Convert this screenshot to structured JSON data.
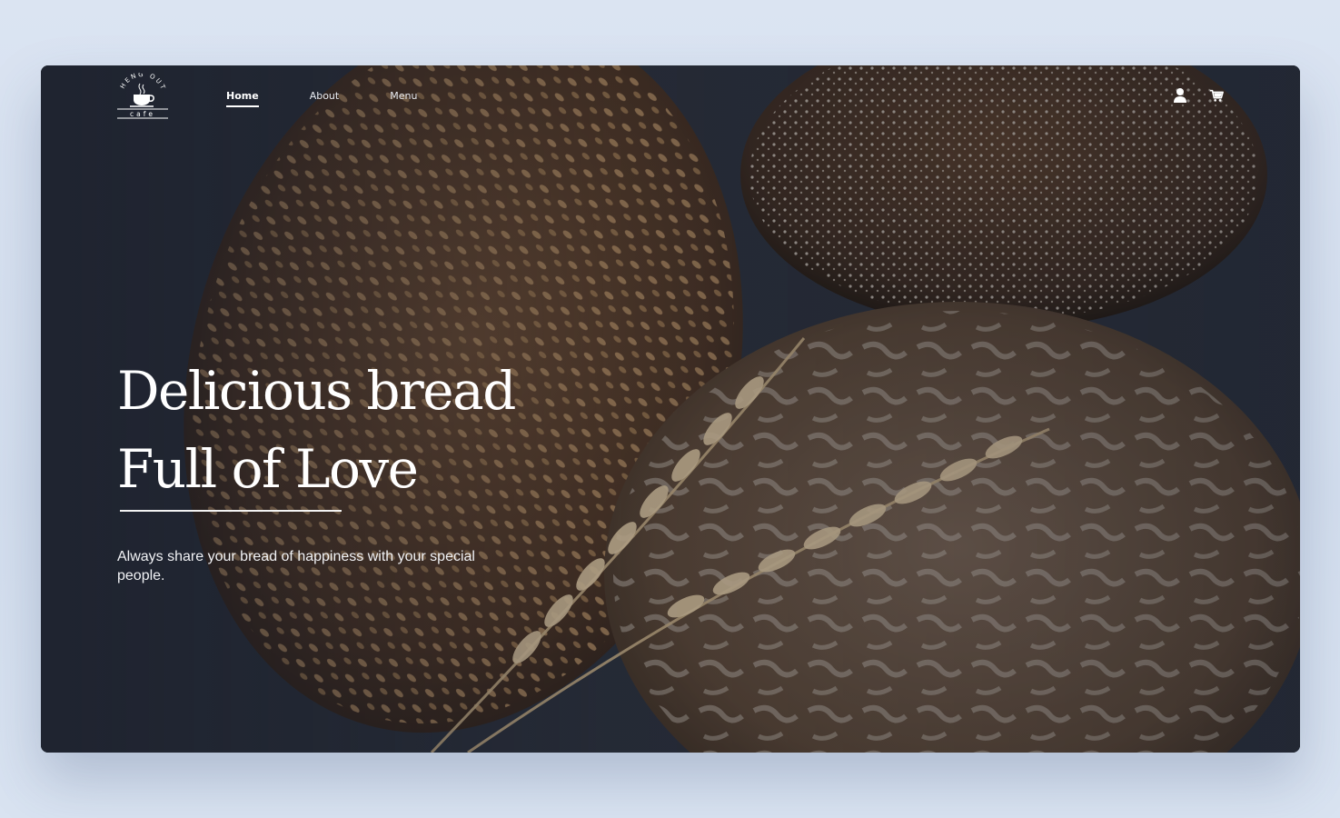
{
  "brand": {
    "logo_arc_text": "HENG OUT",
    "logo_sub_text": "cafe"
  },
  "nav": {
    "items": [
      {
        "label": "Home",
        "active": true
      },
      {
        "label": "About",
        "active": false
      },
      {
        "label": "Menu",
        "active": false
      }
    ],
    "icons": [
      "user-icon",
      "cart-icon"
    ]
  },
  "hero": {
    "headline_line1": "Delicious bread",
    "headline_line2": "Full of Love",
    "tagline": "Always share your bread of happiness with your special people."
  },
  "colors": {
    "page_bg": "#d7e2f1",
    "text": "#ffffff"
  }
}
